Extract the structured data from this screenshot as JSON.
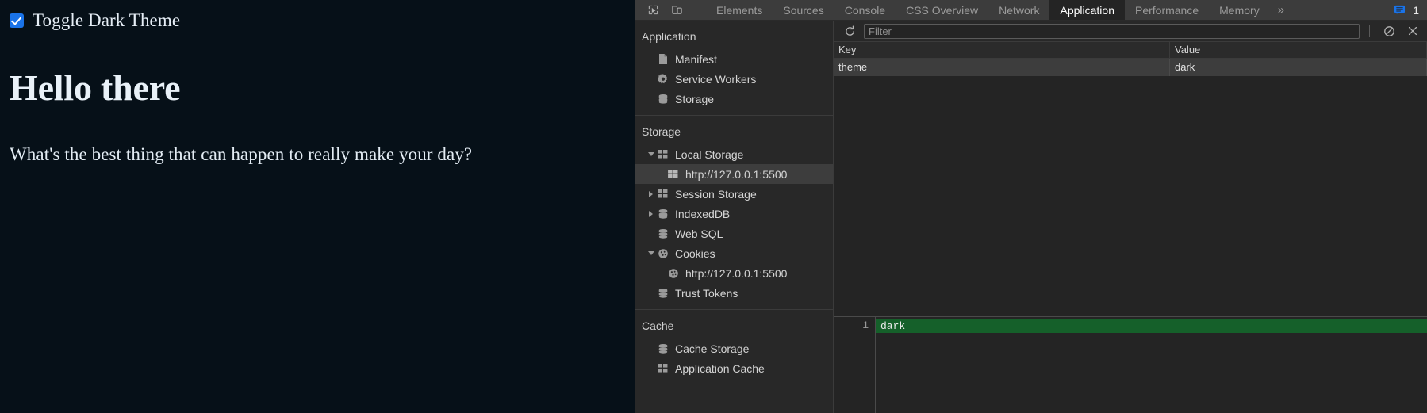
{
  "webpage": {
    "toggle_label": "Toggle Dark Theme",
    "checkbox_checked": true,
    "heading": "Hello there",
    "paragraph": "What's the best thing that can happen to really make your day?",
    "background_color": "#061018",
    "text_color": "#e6eef6",
    "checkbox_color": "#1a73e8"
  },
  "devtools": {
    "tabs": [
      {
        "label": "Elements",
        "active": false
      },
      {
        "label": "Sources",
        "active": false
      },
      {
        "label": "Console",
        "active": false
      },
      {
        "label": "CSS Overview",
        "active": false
      },
      {
        "label": "Network",
        "active": false
      },
      {
        "label": "Application",
        "active": true
      },
      {
        "label": "Performance",
        "active": false
      },
      {
        "label": "Memory",
        "active": false
      }
    ],
    "more_tabs_label": "»",
    "inspect_icon": "inspect-element-icon",
    "device_icon": "device-toolbar-icon",
    "message_count": "1",
    "message_icon_color": "#1a73e8",
    "active_tab_color": "#ffffff",
    "sidebar": {
      "sections": [
        {
          "title": "Application",
          "items": [
            {
              "label": "Manifest",
              "icon": "manifest-document-icon",
              "indent": 1,
              "twisty": "none",
              "selected": false
            },
            {
              "label": "Service Workers",
              "icon": "gear-icon",
              "indent": 1,
              "twisty": "none",
              "selected": false
            },
            {
              "label": "Storage",
              "icon": "database-icon",
              "indent": 1,
              "twisty": "none",
              "selected": false
            }
          ]
        },
        {
          "title": "Storage",
          "items": [
            {
              "label": "Local Storage",
              "icon": "table-grid-icon",
              "indent": 1,
              "twisty": "open",
              "selected": false
            },
            {
              "label": "http://127.0.0.1:5500",
              "icon": "table-grid-icon",
              "indent": 2,
              "twisty": "none",
              "selected": true
            },
            {
              "label": "Session Storage",
              "icon": "table-grid-icon",
              "indent": 1,
              "twisty": "closed",
              "selected": false
            },
            {
              "label": "IndexedDB",
              "icon": "database-icon",
              "indent": 1,
              "twisty": "closed",
              "selected": false
            },
            {
              "label": "Web SQL",
              "icon": "database-icon",
              "indent": 1,
              "twisty": "none",
              "selected": false
            },
            {
              "label": "Cookies",
              "icon": "cookie-icon",
              "indent": 1,
              "twisty": "open",
              "selected": false
            },
            {
              "label": "http://127.0.0.1:5500",
              "icon": "cookie-icon",
              "indent": 2,
              "twisty": "none",
              "selected": false
            },
            {
              "label": "Trust Tokens",
              "icon": "database-icon",
              "indent": 1,
              "twisty": "none",
              "selected": false
            }
          ]
        },
        {
          "title": "Cache",
          "items": [
            {
              "label": "Cache Storage",
              "icon": "database-icon",
              "indent": 1,
              "twisty": "none",
              "selected": false
            },
            {
              "label": "Application Cache",
              "icon": "table-grid-icon",
              "indent": 1,
              "twisty": "none",
              "selected": false
            }
          ]
        }
      ]
    },
    "toolbar": {
      "refresh_icon": "refresh-icon",
      "filter_placeholder": "Filter",
      "filter_value": "",
      "clear_all_icon": "clear-all-no-entry-icon",
      "delete_selected_icon": "delete-x-icon"
    },
    "storage_table": {
      "columns": [
        "Key",
        "Value"
      ],
      "rows": [
        {
          "key": "theme",
          "value": "dark"
        }
      ]
    },
    "preview": {
      "line_number": "1",
      "content": "dark",
      "highlight_color": "#15602a"
    }
  }
}
